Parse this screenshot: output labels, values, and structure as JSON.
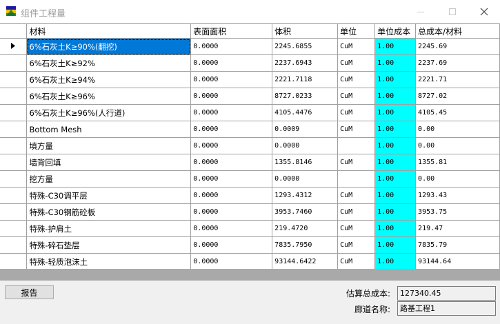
{
  "window": {
    "title": "组件工程量"
  },
  "columns": [
    "材料",
    "表面面积",
    "体积",
    "单位",
    "单位成本",
    "总成本/材料"
  ],
  "rows": [
    {
      "material": "6%石灰土K≥90%(翻挖)",
      "area": "0.0000",
      "volume": "2245.6855",
      "unit": "CuM",
      "unit_cost": "1.00",
      "total": "2245.69"
    },
    {
      "material": "6%石灰土K≥92%",
      "area": "0.0000",
      "volume": "2237.6943",
      "unit": "CuM",
      "unit_cost": "1.00",
      "total": "2237.69"
    },
    {
      "material": "6%石灰土K≥94%",
      "area": "0.0000",
      "volume": "2221.7118",
      "unit": "CuM",
      "unit_cost": "1.00",
      "total": "2221.71"
    },
    {
      "material": "6%石灰土K≥96%",
      "area": "0.0000",
      "volume": "8727.0233",
      "unit": "CuM",
      "unit_cost": "1.00",
      "total": "8727.02"
    },
    {
      "material": "6%石灰土K≥96%(人行道)",
      "area": "0.0000",
      "volume": "4105.4476",
      "unit": "CuM",
      "unit_cost": "1.00",
      "total": "4105.45"
    },
    {
      "material": "Bottom Mesh",
      "area": "0.0000",
      "volume": "0.0009",
      "unit": "CuM",
      "unit_cost": "1.00",
      "total": "0.00"
    },
    {
      "material": "填方量",
      "area": "0.0000",
      "volume": "0.0000",
      "unit": "",
      "unit_cost": "1.00",
      "total": "0.00"
    },
    {
      "material": "墙背回填",
      "area": "0.0000",
      "volume": "1355.8146",
      "unit": "CuM",
      "unit_cost": "1.00",
      "total": "1355.81"
    },
    {
      "material": "挖方量",
      "area": "0.0000",
      "volume": "0.0000",
      "unit": "",
      "unit_cost": "1.00",
      "total": "0.00"
    },
    {
      "material": "特殊-C30调平层",
      "area": "0.0000",
      "volume": "1293.4312",
      "unit": "CuM",
      "unit_cost": "1.00",
      "total": "1293.43"
    },
    {
      "material": "特殊-C30钢筋砼板",
      "area": "0.0000",
      "volume": "3953.7460",
      "unit": "CuM",
      "unit_cost": "1.00",
      "total": "3953.75"
    },
    {
      "material": "特殊-护肩土",
      "area": "0.0000",
      "volume": "219.4720",
      "unit": "CuM",
      "unit_cost": "1.00",
      "total": "219.47"
    },
    {
      "material": "特殊-碎石垫层",
      "area": "0.0000",
      "volume": "7835.7950",
      "unit": "CuM",
      "unit_cost": "1.00",
      "total": "7835.79"
    },
    {
      "material": "特殊-轻质泡沫土",
      "area": "0.0000",
      "volume": "93144.6422",
      "unit": "CuM",
      "unit_cost": "1.00",
      "total": "93144.64"
    }
  ],
  "footer": {
    "report_label": "报告",
    "total_label": "估算总成本:",
    "total_value": "127340.45",
    "corridor_label": "廊道名称:",
    "corridor_value": "路基工程1"
  }
}
